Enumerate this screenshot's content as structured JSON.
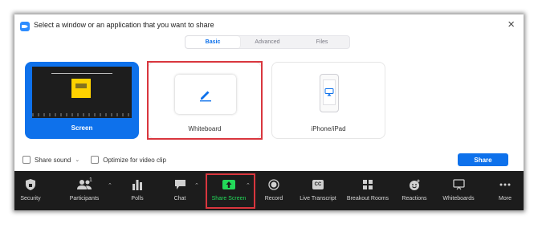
{
  "dialog": {
    "title": "Select a window or an application that you want to share",
    "close": "×"
  },
  "tabs": [
    {
      "label": "Basic",
      "active": true
    },
    {
      "label": "Advanced",
      "active": false
    },
    {
      "label": "Files",
      "active": false
    }
  ],
  "options": {
    "screen": {
      "label": "Screen",
      "selected": true
    },
    "whiteboard": {
      "label": "Whiteboard",
      "highlighted": true
    },
    "iphone": {
      "label": "iPhone/iPad"
    }
  },
  "controls": {
    "share_sound": "Share sound",
    "optimize_video": "Optimize for video clip",
    "share_button": "Share"
  },
  "toolbar": {
    "security": "Security",
    "participants": "Participants",
    "participants_count": "1",
    "polls": "Polls",
    "chat": "Chat",
    "share_screen": "Share Screen",
    "record": "Record",
    "live_transcript": "Live Transcript",
    "breakout_rooms": "Breakout Rooms",
    "reactions": "Reactions",
    "whiteboards": "Whiteboards",
    "more": "More",
    "cc_text": "CC"
  },
  "colors": {
    "accent": "#0e71eb",
    "highlight": "#d9363e",
    "share_green": "#23d959",
    "toolbar_bg": "#1c1c1c"
  }
}
